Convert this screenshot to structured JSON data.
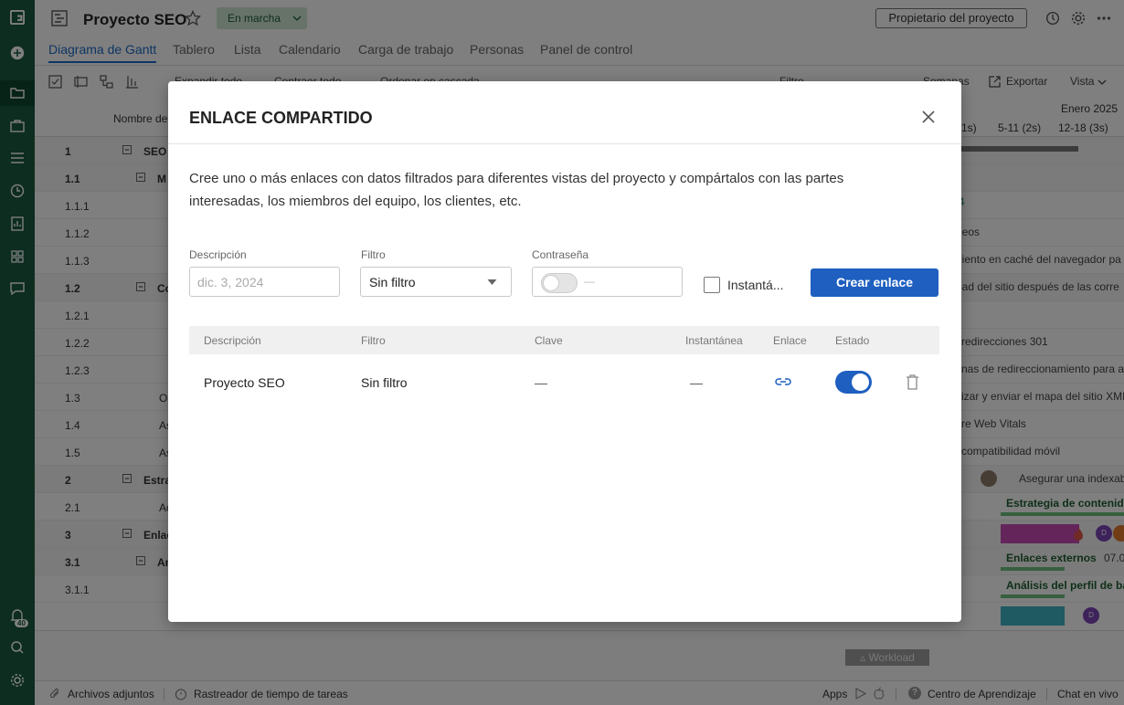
{
  "app": {
    "logo": "G"
  },
  "header": {
    "project_title": "Proyecto SEO",
    "status": "En marcha",
    "owner_button": "Propietario del proyecto"
  },
  "tabs": [
    {
      "label": "Diagrama de Gantt",
      "active": true
    },
    {
      "label": "Tablero"
    },
    {
      "label": "Lista"
    },
    {
      "label": "Calendario"
    },
    {
      "label": "Carga de trabajo"
    },
    {
      "label": "Personas"
    },
    {
      "label": "Panel de control"
    }
  ],
  "toolbar": {
    "expand": "Expandir todo",
    "collapse": "Contraer todo",
    "order": "Ordenar en cascada",
    "filter": "Filtro",
    "weeks": "Semanas",
    "export": "Exportar",
    "view": "Vista"
  },
  "grid": {
    "name_header": "Nombre de",
    "month": "Enero 2025",
    "week1": "(1s)",
    "week2": "5-11 (2s)",
    "week3": "12-18 (3s)"
  },
  "rows": [
    {
      "num": "1",
      "name": "SEO",
      "bold": true
    },
    {
      "num": "1.1",
      "name": "M",
      "bold": true
    },
    {
      "num": "1.1.1"
    },
    {
      "num": "1.1.2"
    },
    {
      "num": "1.1.3"
    },
    {
      "num": "1.2",
      "name": "Co",
      "bold": true
    },
    {
      "num": "1.2.1"
    },
    {
      "num": "1.2.2"
    },
    {
      "num": "1.2.3"
    },
    {
      "num": "1.3",
      "name": "O"
    },
    {
      "num": "1.4",
      "name": "As"
    },
    {
      "num": "1.5",
      "name": "As"
    },
    {
      "num": "2",
      "name": "Estra",
      "bold": true
    },
    {
      "num": "2.1",
      "name": "Ac"
    },
    {
      "num": "3",
      "name": "Enlac",
      "bold": true
    },
    {
      "num": "3.1",
      "name": "An",
      "bold": true
    },
    {
      "num": "3.1.1"
    }
  ],
  "gantt_texts": {
    "t1": "4",
    "t2": "deos",
    "t3": "niento en caché del navegador pa",
    "t4": "dad del sitio después de las corre",
    "t5": "redirecciones 301",
    "t6": "nas de redireccionamiento para ag",
    "t7": "izar y enviar el mapa del sitio XML",
    "t8": "re Web Vitals",
    "t9": "compatibilidad móvil",
    "t10": "Asegurar una indexab",
    "t11": "Estrategia de contenid",
    "t12": "Enlaces externos",
    "t12b": "07.0",
    "t13": "Análisis del perfil de ba"
  },
  "workload": "Workload",
  "footer": {
    "attachments": "Archivos adjuntos",
    "tracker": "Rastreador de tiempo de tareas",
    "apps": "Apps",
    "learning": "Centro de Aprendizaje",
    "chat": "Chat en vivo"
  },
  "notifications_count": "40",
  "modal": {
    "title": "ENLACE COMPARTIDO",
    "description": "Cree uno o más enlaces con datos filtrados para diferentes vistas del proyecto y compártalos con las partes interesadas, los miembros del equipo, los clientes, etc.",
    "form": {
      "description_label": "Descripción",
      "description_placeholder": "dic. 3, 2024",
      "filter_label": "Filtro",
      "filter_value": "Sin filtro",
      "password_label": "Contraseña",
      "password_dash": "—",
      "snapshot_label": "Instantá...",
      "create_button": "Crear enlace"
    },
    "table": {
      "headers": [
        "Descripción",
        "Filtro",
        "Clave",
        "Instantánea",
        "Enlace",
        "Estado"
      ],
      "rows": [
        {
          "description": "Proyecto SEO",
          "filter": "Sin filtro",
          "key": "—",
          "snapshot": "—",
          "active": true
        }
      ]
    }
  },
  "colors": {
    "sidebar": "#185a3f",
    "accent": "#1e5fc0",
    "status_bg": "#cfe6d2",
    "bar_magenta": "#c84bb5",
    "bar_teal": "#3fb3c4",
    "bar_green": "#6cbf7c"
  }
}
